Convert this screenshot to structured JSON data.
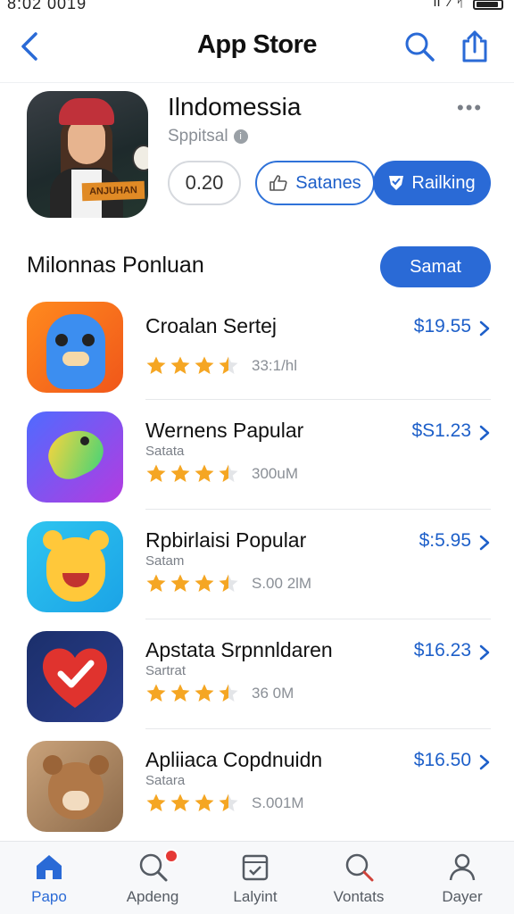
{
  "status_bar": {
    "time": "8:02 0019"
  },
  "nav": {
    "title": "App Store"
  },
  "app": {
    "name": "Ilndomessia",
    "subtitle": "Sppitsal",
    "icon_text": "ANJUHAN",
    "rating_value": "0.20",
    "secondary_label": "Satanes",
    "primary_label": "Railking"
  },
  "section": {
    "title": "Milonnas Ponluan",
    "button_label": "Samat"
  },
  "list": [
    {
      "title": "Croalan Sertej",
      "subtitle": "",
      "reviews": "33:1/hl",
      "price": "$19.55",
      "rating": 3.5,
      "icon": "blue-creature-icon"
    },
    {
      "title": "Wernens Papular",
      "subtitle": "Satata",
      "reviews": "300uM",
      "price": "$S1.23",
      "rating": 3.5,
      "icon": "bird-icon"
    },
    {
      "title": "Rpbirlaisi Popular",
      "subtitle": "Satam",
      "reviews": "S.00 2lM",
      "price": "$:5.95",
      "rating": 3.5,
      "icon": "bear-smile-icon"
    },
    {
      "title": "Apstata Srpnnldaren",
      "subtitle": "Sartrat",
      "reviews": "36 0M",
      "price": "$16.23",
      "rating": 3.5,
      "icon": "heart-check-icon"
    },
    {
      "title": "Apliiaca Copdnuidn",
      "subtitle": "Satara",
      "reviews": "S.001M",
      "price": "$16.50",
      "rating": 3.5,
      "icon": "bear-icon"
    }
  ],
  "tabs": [
    {
      "label": "Papo",
      "icon": "home-icon",
      "active": true
    },
    {
      "label": "Apdeng",
      "icon": "search-badge-icon",
      "active": false
    },
    {
      "label": "Lalyint",
      "icon": "calendar-icon",
      "active": false
    },
    {
      "label": "Vontats",
      "icon": "search-icon",
      "active": false
    },
    {
      "label": "Dayer",
      "icon": "person-icon",
      "active": false
    }
  ],
  "colors": {
    "accent": "#2a6ad6",
    "price": "#1d5fc9",
    "star": "#f5a623"
  }
}
